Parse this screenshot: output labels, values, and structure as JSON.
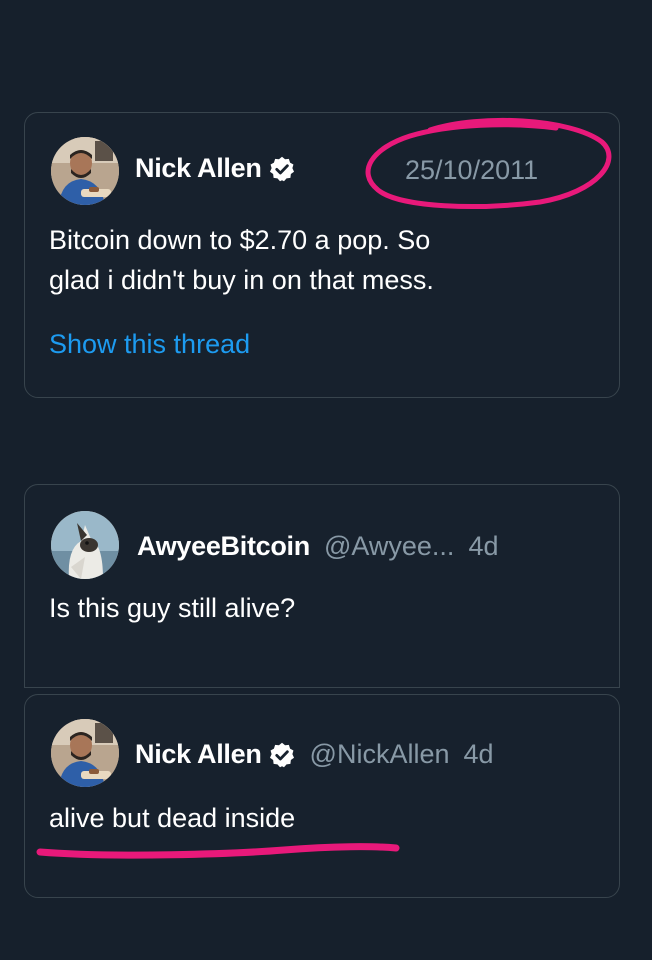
{
  "tweets": [
    {
      "name": "Nick Allen",
      "date": "25/10/2011",
      "text_line_1": "Bitcoin down to $2.70 a pop. So",
      "text_line_2": "glad i didn't buy in on that mess.",
      "thread_link": "Show this thread",
      "verified": true,
      "avatar_icon": "user-photo-icon"
    },
    {
      "name": "AwyeeBitcoin",
      "handle": "@Awyee...",
      "time": "4d",
      "text": "Is this guy still alive?",
      "verified": false,
      "avatar_icon": "dog-photo-icon"
    },
    {
      "name": "Nick Allen",
      "handle": "@NickAllen",
      "time": "4d",
      "text": "alive but dead inside",
      "verified": true,
      "avatar_icon": "user-photo-icon"
    }
  ],
  "colors": {
    "background": "#16202c",
    "card_border": "#38444d",
    "link": "#1d9bf0",
    "muted": "#8899a6",
    "annotation": "#e8197a"
  }
}
